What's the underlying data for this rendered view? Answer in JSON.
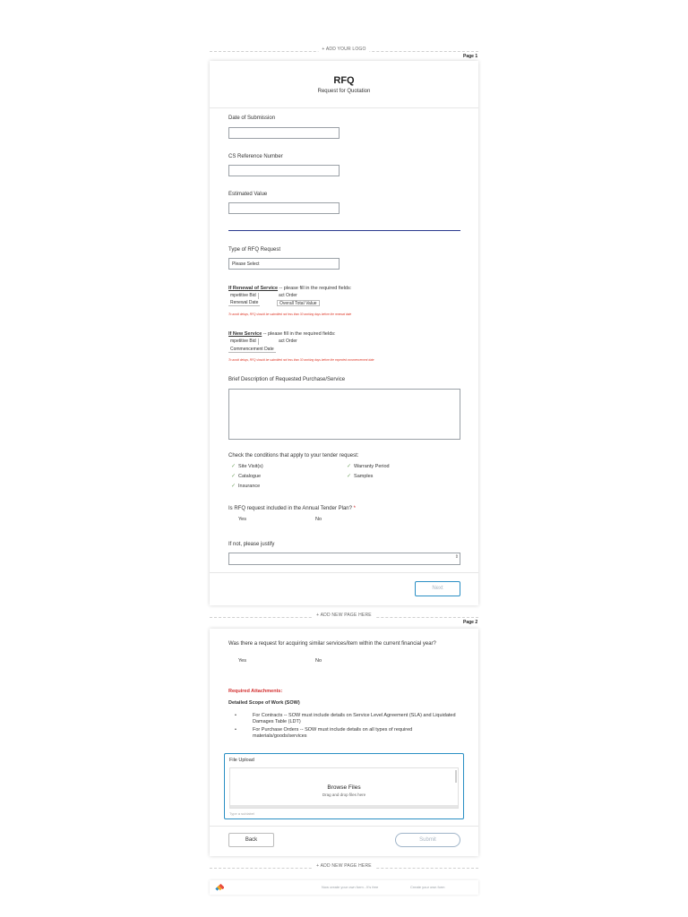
{
  "top": {
    "add_logo": "+ ADD YOUR LOGO",
    "page1": "Page 1"
  },
  "form": {
    "title": "RFQ",
    "subtitle": "Request for Quotation",
    "date_label": "Date of Submission",
    "cs_label": "CS Reference Number",
    "estimated_label": "Estimated Value",
    "type_label": "Type of RFQ Request",
    "type_value": "Please Select",
    "renewal": {
      "head": "If Renewal of Service",
      "tail": " -- please fill in the required fields:",
      "bid": "mpetitive Bid",
      "order": "act Order",
      "date": "Renewal Date",
      "total": "Overall Total Value",
      "warning": "To avoid delays, RFQ should be submitted not less than 30 working days before the renewal date"
    },
    "newservice": {
      "head": "If New Service",
      "tail": " -- please fill in the required fields:",
      "bid": "mpetitive Bid",
      "order": "act Order",
      "date": "Commencement Date",
      "warning": "To avoid delays, RFQ should be submitted not less than 30 working days before the expected commencement date"
    },
    "brief_label": "Brief Description of Requested Purchase/Service",
    "conditions_label": "Check the conditions that apply to your tender request:",
    "conditions": {
      "site_visit": "Site Visit(s)",
      "warranty": "Warranty Period",
      "catalogue": "Catalogue",
      "samples": "Samples",
      "insurance": "Insurance"
    },
    "annual_label": "Is RFQ request included in the Annual Tender Plan?",
    "required_star": "*",
    "yes": "Yes",
    "no": "No",
    "justify_label": "If not, please justify",
    "next": "Next"
  },
  "divider1": {
    "add_page": "+ ADD NEW PAGE HERE",
    "page2": "Page 2"
  },
  "page2": {
    "question": "Was there a request for acquiring similar services/item within the current financial year?",
    "yes": "Yes",
    "no": "No",
    "required_attachments": "Required Attachments:",
    "sow_label": "Detailed Scope of Work (SOW)",
    "bullet1": "For Contracts -- SOW must include details on Service Level Agreement (SLA) and Liquidated Damages Table (LDT)",
    "bullet2": "For Purchase Orders -- SOW must include details on all types of required materials/goods/services",
    "upload_label": "File Upload",
    "browse": "Browse Files",
    "drag": "Drag and drop files here",
    "sublabel": "Type a sublabel",
    "back": "Back",
    "submit": "Submit"
  },
  "divider2": {
    "add_page": "+ ADD NEW PAGE HERE"
  },
  "footer": {
    "now_create": "Now create your own form - It's free",
    "create_form": "Create your own form"
  },
  "colors": {
    "accent": "#2a8fc4",
    "divider": "#2b3a8f",
    "danger": "#d32f2f"
  }
}
